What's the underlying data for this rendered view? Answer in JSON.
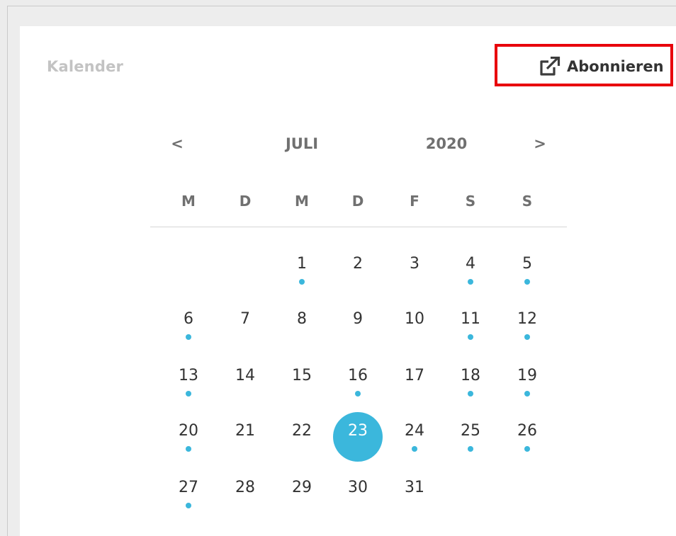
{
  "panel": {
    "title": "Kalender"
  },
  "subscribe": {
    "label": "Abonnieren",
    "icon": "external-link-icon"
  },
  "calendar": {
    "prev_label": "<",
    "next_label": ">",
    "month": "JULI",
    "year": "2020",
    "weekdays": [
      "M",
      "D",
      "M",
      "D",
      "F",
      "S",
      "S"
    ],
    "selected_day": "23",
    "weeks": [
      [
        null,
        null,
        {
          "day": "1",
          "event": true
        },
        {
          "day": "2",
          "event": false
        },
        {
          "day": "3",
          "event": false
        },
        {
          "day": "4",
          "event": true
        },
        {
          "day": "5",
          "event": true
        }
      ],
      [
        {
          "day": "6",
          "event": true
        },
        {
          "day": "7",
          "event": false
        },
        {
          "day": "8",
          "event": false
        },
        {
          "day": "9",
          "event": false
        },
        {
          "day": "10",
          "event": false
        },
        {
          "day": "11",
          "event": true
        },
        {
          "day": "12",
          "event": true
        }
      ],
      [
        {
          "day": "13",
          "event": true
        },
        {
          "day": "14",
          "event": false
        },
        {
          "day": "15",
          "event": false
        },
        {
          "day": "16",
          "event": true
        },
        {
          "day": "17",
          "event": false
        },
        {
          "day": "18",
          "event": true
        },
        {
          "day": "19",
          "event": true
        }
      ],
      [
        {
          "day": "20",
          "event": true
        },
        {
          "day": "21",
          "event": false
        },
        {
          "day": "22",
          "event": false
        },
        {
          "day": "23",
          "event": false
        },
        {
          "day": "24",
          "event": true
        },
        {
          "day": "25",
          "event": true
        },
        {
          "day": "26",
          "event": true
        }
      ],
      [
        {
          "day": "27",
          "event": true
        },
        {
          "day": "28",
          "event": false
        },
        {
          "day": "29",
          "event": false
        },
        {
          "day": "30",
          "event": false
        },
        {
          "day": "31",
          "event": false
        },
        null,
        null
      ]
    ]
  },
  "colors": {
    "accent": "#3bb7dc",
    "highlight_border": "#e8000b"
  }
}
